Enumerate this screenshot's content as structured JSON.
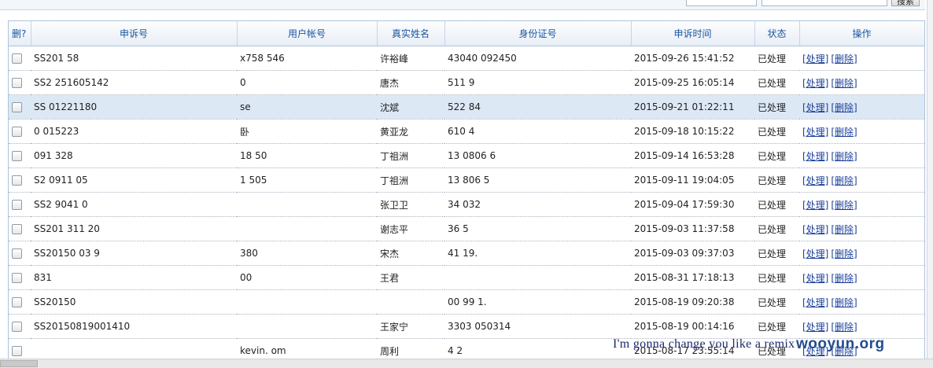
{
  "toolbar": {
    "select_value": "",
    "search_placeholder": "",
    "search_button": "搜索"
  },
  "table": {
    "columns": [
      "删?",
      "申诉号",
      "用户帐号",
      "真实姓名",
      "身份证号",
      "申诉时间",
      "状态",
      "操作"
    ],
    "action_process": "[处理]",
    "action_delete": "[删除]",
    "rows": [
      {
        "appeal_no": "SS201           58",
        "account": "x758     546",
        "name": "许裕峰",
        "id_no": "43040       092450",
        "time": "2015-09-26 15:41:52",
        "status": "已处理"
      },
      {
        "appeal_no": "SS2     251605142",
        "account": "                0",
        "name": "唐杰",
        "id_no": "511            9",
        "time": "2015-09-25 16:05:14",
        "status": "已处理"
      },
      {
        "appeal_no": "SS          01221180",
        "account": "se",
        "name": "沈斌",
        "id_no": "522                84",
        "time": "2015-09-21 01:22:11",
        "status": "已处理"
      },
      {
        "appeal_no": "          0      015223",
        "account": "卧",
        "name": "黄亚龙",
        "id_no": "610             4",
        "time": "2015-09-18 10:15:22",
        "status": "已处理"
      },
      {
        "appeal_no": "          091     328",
        "account": "18          50",
        "name": "丁祖洲",
        "id_no": "13          0806       6",
        "time": "2015-09-14 16:53:28",
        "status": "已处理"
      },
      {
        "appeal_no": "  S2     0911     05",
        "account": "1           505",
        "name": "丁祖洲",
        "id_no": "13           806       5",
        "time": "2015-09-11 19:04:05",
        "status": "已处理"
      },
      {
        "appeal_no": "SS2      9041     0",
        "account": "",
        "name": "张卫卫",
        "id_no": "34                032",
        "time": "2015-09-04 17:59:30",
        "status": "已处理"
      },
      {
        "appeal_no": "SS201        311     20",
        "account": "",
        "name": "谢志平",
        "id_no": "36                 5",
        "time": "2015-09-03 11:37:58",
        "status": "已处理"
      },
      {
        "appeal_no": "  SS20150       03      9",
        "account": "                 380",
        "name": "宋杰",
        "id_no": "41            19.",
        "time": "2015-09-03 09:37:03",
        "status": "已处理"
      },
      {
        "appeal_no": "          831",
        "account": "       00",
        "name": "王君",
        "id_no": "",
        "time": "2015-08-31 17:18:13",
        "status": "已处理"
      },
      {
        "appeal_no": "SS20150",
        "account": "",
        "name": "",
        "id_no": "       00        99       1.",
        "time": "2015-08-19 09:20:38",
        "status": "已处理"
      },
      {
        "appeal_no": "SS20150819001410",
        "account": "",
        "name": "王家宁",
        "id_no": "3303         050314",
        "time": "2015-08-19 00:14:16",
        "status": "已处理"
      },
      {
        "appeal_no": "",
        "account": "kevin.          om",
        "name": "周利",
        "id_no": "4                       2",
        "time": "2015-08-17 23:55:14",
        "status": "已处理"
      }
    ]
  },
  "watermark": {
    "text": "I'm gonna change you like a remix",
    "brand": "wooyun.org"
  }
}
